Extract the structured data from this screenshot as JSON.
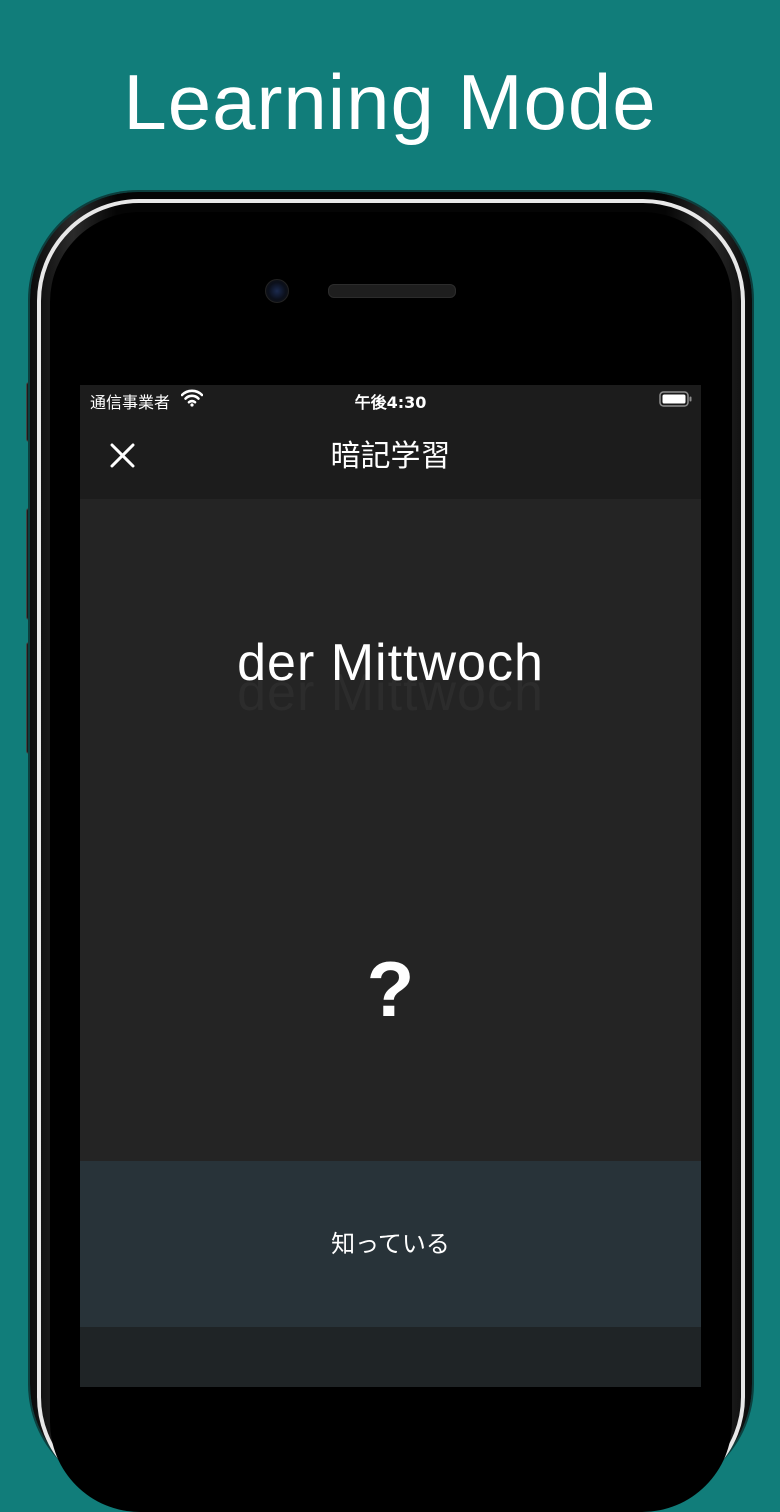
{
  "promo": {
    "title": "Learning Mode"
  },
  "status_bar": {
    "carrier": "通信事業者",
    "time": "午後4:30"
  },
  "nav": {
    "title": "暗記学習"
  },
  "card": {
    "word": "der Mittwoch",
    "answer_placeholder": "?"
  },
  "actions": {
    "know_label": "知っている"
  },
  "colors": {
    "background": "#117d7a",
    "screen": "#232323",
    "button": "#283339"
  },
  "icons": {
    "close": "close-icon",
    "wifi": "wifi-icon",
    "battery": "battery-icon"
  }
}
